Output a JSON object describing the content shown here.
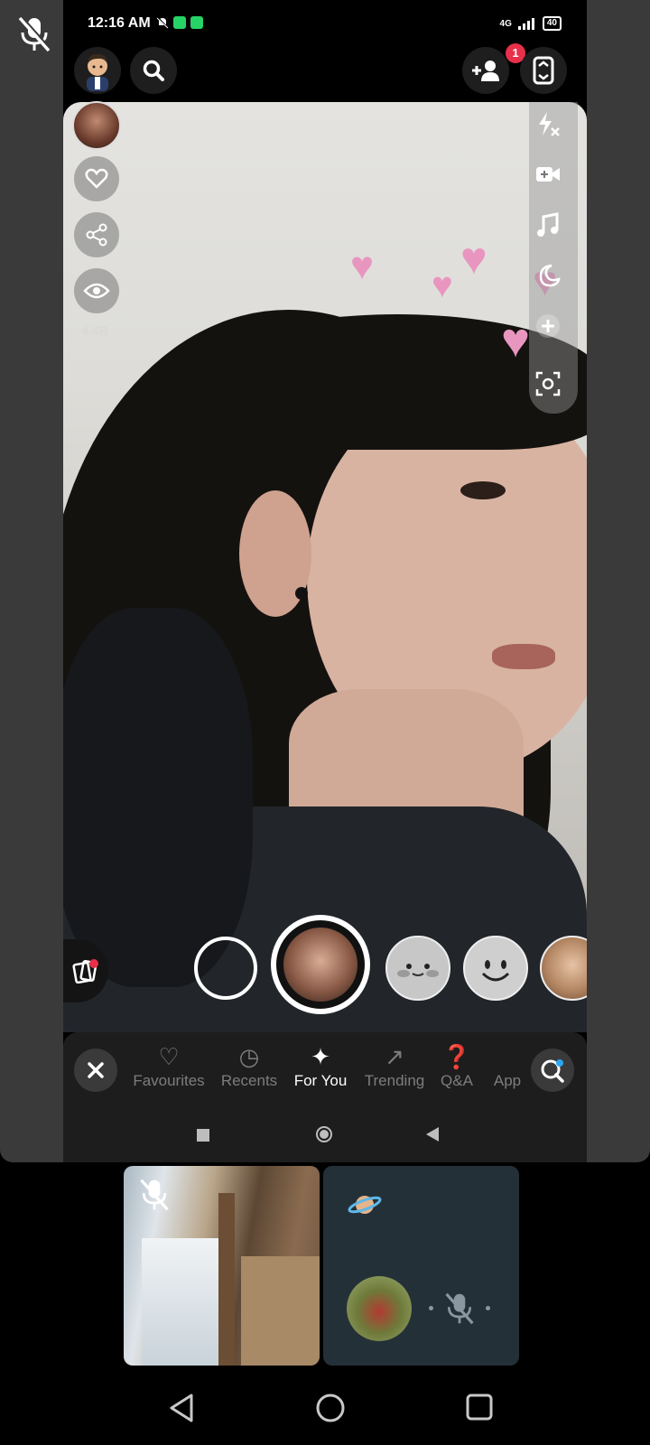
{
  "status_bar": {
    "time": "12:16 AM",
    "network": "4G",
    "battery": "40"
  },
  "left_rail": {
    "views_count": "4.4B"
  },
  "friend_badge": "1",
  "lens_tabs": [
    {
      "label": "Favourites",
      "icon": "heart-outline-icon",
      "active": false
    },
    {
      "label": "Recents",
      "icon": "history-icon",
      "active": false
    },
    {
      "label": "For You",
      "icon": "sparkle-icon",
      "active": true
    },
    {
      "label": "Trending",
      "icon": "trending-icon",
      "active": false
    },
    {
      "label": "Q&A",
      "icon": "question-icon",
      "active": false
    },
    {
      "label": "App",
      "icon": "apps-icon",
      "active": false
    }
  ],
  "colors": {
    "heart": "#e896bf",
    "badge": "#e8304a",
    "panel_bg": "#3a3a3a",
    "pip_bg": "#243038"
  }
}
